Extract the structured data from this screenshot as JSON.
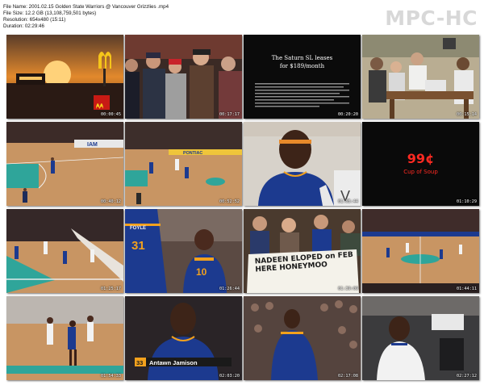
{
  "header": {
    "file_name": "File Name: 2001.02.15 Golden State Warriors @ Vancouver Grizzlies .mp4",
    "file_size": "File Size: 12.2 GB (13,108,759,501 bytes)",
    "resolution": "Resolution: 654x480 (15:11)",
    "duration": "Duration: 02:29:46"
  },
  "logo": "MPC-HC",
  "thumbnails": [
    {
      "timestamp": "00:00:45",
      "scene": "mcdonalds-sunset-ad"
    },
    {
      "timestamp": "00:17:17",
      "scene": "crowd-fans"
    },
    {
      "timestamp": "00:20:20",
      "scene": "saturn-ad",
      "title": "The Saturn SL leases",
      "subtitle": "for $189/month"
    },
    {
      "timestamp": "00:15:14",
      "scene": "family-kitchen"
    },
    {
      "timestamp": "00:40:12",
      "scene": "court-wide",
      "banner": "IAM"
    },
    {
      "timestamp": "00:52:52",
      "scene": "court-wide-2",
      "banner": "PONTIAC"
    },
    {
      "timestamp": "01:05:44",
      "scene": "player-closeup"
    },
    {
      "timestamp": "01:10:29",
      "scene": "soup-ad",
      "price": "99¢",
      "caption": "Cup of Soup"
    },
    {
      "timestamp": "01:25:17",
      "scene": "court-angle"
    },
    {
      "timestamp": "01:26:44",
      "scene": "players-31-10",
      "jersey_number": "31",
      "jersey_name": "FOYLE"
    },
    {
      "timestamp": "01:39:09",
      "scene": "fans-sign",
      "sign_text": "NADEEN ELOPED on FEB HERE HONEYMOO"
    },
    {
      "timestamp": "01:44:11",
      "scene": "court-overhead"
    },
    {
      "timestamp": "01:54:33",
      "scene": "court-action"
    },
    {
      "timestamp": "02:03:20",
      "scene": "player-name-graphic",
      "graphic_number": "33",
      "graphic_name": "Antawn Jamison"
    },
    {
      "timestamp": "02:17:08",
      "scene": "player-back"
    },
    {
      "timestamp": "02:27:12",
      "scene": "player-bench"
    }
  ],
  "colors": {
    "warriors_blue": "#1c3a8f",
    "warriors_gold": "#f2a11d",
    "court_floor": "#c89563",
    "court_teal": "#2fa59a"
  }
}
